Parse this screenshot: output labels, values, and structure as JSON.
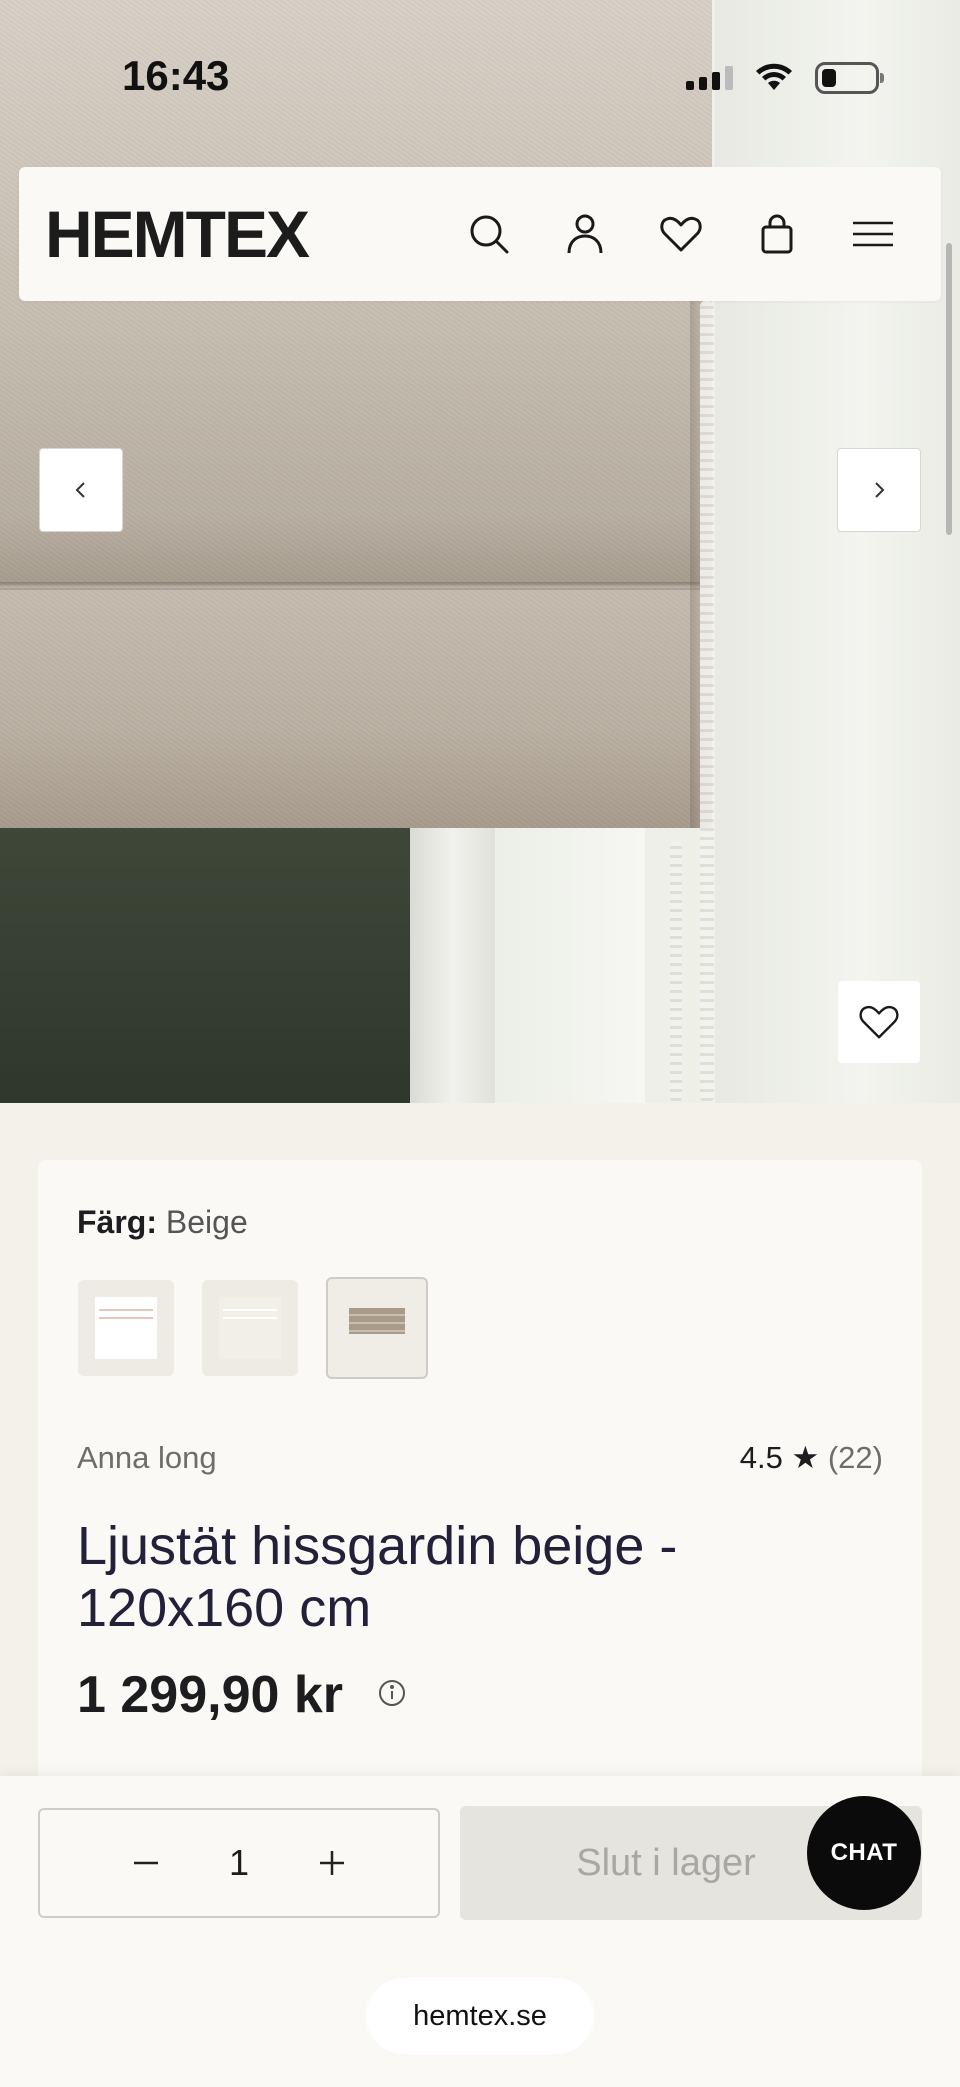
{
  "status": {
    "time": "16:43"
  },
  "header": {
    "logo": "HEMTEX",
    "icons": [
      "search-icon",
      "account-icon",
      "heart-icon",
      "bag-icon",
      "menu-icon"
    ]
  },
  "product": {
    "color_label": "Färg:",
    "color_value": "Beige",
    "swatches": [
      "white",
      "off-white",
      "beige"
    ],
    "selected_swatch": "beige",
    "brand": "Anna long",
    "rating": "4.5 ★",
    "rating_count": "(22)",
    "title": "Ljustät hissgardin beige - 120x160 cm",
    "price": "1 299,90 kr"
  },
  "cart": {
    "quantity": "1",
    "soldout_label": "Slut i lager",
    "chat_label": "CHAT"
  },
  "browser": {
    "url": "hemtex.se"
  },
  "colors": {
    "page_bg": "#f4f1eb",
    "card_bg": "#faf9f5",
    "chat_bg": "#0b0b0b",
    "title_color": "#23203a",
    "soldout_bg": "#e6e4df"
  }
}
